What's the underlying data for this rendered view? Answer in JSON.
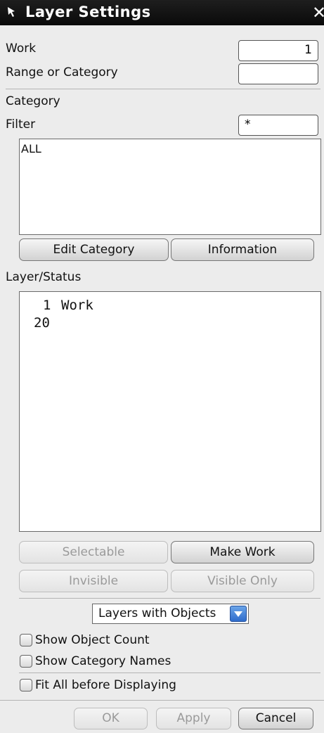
{
  "window": {
    "title": "Layer Settings",
    "close_glyph": "✕"
  },
  "work": {
    "label": "Work",
    "value": "1"
  },
  "range": {
    "label": "Range or Category",
    "value": ""
  },
  "category": {
    "section_label": "Category",
    "filter_label": "Filter",
    "filter_value": "*",
    "items": [
      "ALL"
    ],
    "edit_button": "Edit Category",
    "info_button": "Information"
  },
  "layer_status": {
    "label": "Layer/Status",
    "rows": [
      {
        "layer": "1",
        "status": "Work"
      },
      {
        "layer": "20",
        "status": ""
      }
    ]
  },
  "layer_buttons": {
    "selectable": "Selectable",
    "make_work": "Make Work",
    "invisible": "Invisible",
    "visible_only": "Visible Only"
  },
  "display_filter": {
    "selected": "Layers with Objects"
  },
  "options": {
    "show_object_count": "Show Object Count",
    "show_category_names": "Show Category Names",
    "fit_all": "Fit All before Displaying"
  },
  "footer": {
    "ok": "OK",
    "apply": "Apply",
    "cancel": "Cancel"
  },
  "icons": {
    "title": "cursor-arrow-icon",
    "close": "close-icon",
    "dropdown": "chevron-down-icon"
  },
  "colors": {
    "titlebar": "#0a0a0a",
    "dropdown_accent": "#2f6ccc",
    "panel": "#ececec"
  }
}
